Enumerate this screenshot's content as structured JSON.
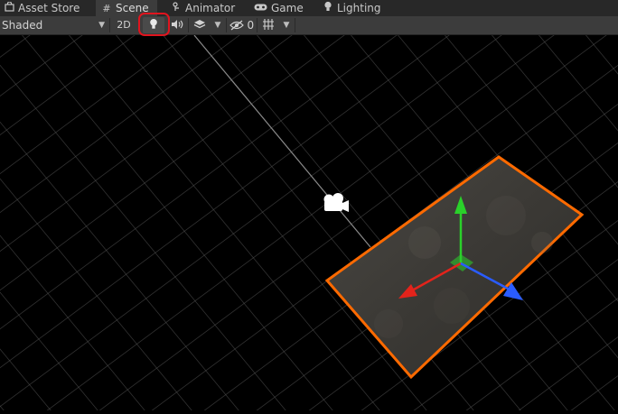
{
  "tabs": [
    {
      "label": "Asset Store",
      "icon": "shopping-bag-icon"
    },
    {
      "label": "Scene",
      "icon": "grid-hash-icon"
    },
    {
      "label": "Animator",
      "icon": "animator-node-icon"
    },
    {
      "label": "Game",
      "icon": "gamepad-icon"
    },
    {
      "label": "Lighting",
      "icon": "lightbulb-icon"
    }
  ],
  "active_tab": "Scene",
  "toolbar": {
    "draw_mode": "Shaded",
    "mode_2d": "2D",
    "lighting_toggle_icon": "lightbulb-icon",
    "audio_toggle_icon": "speaker-icon",
    "effects_icon": "layers-icon",
    "hidden_objects_count": "0",
    "gizmos_icon": "gizmo-grid-icon",
    "highlight_color": "#e0141e"
  },
  "scene": {
    "background_color": "#000000",
    "grid_color": "#5a5a5a",
    "selection_outline_color": "#ff6a00",
    "axis_colors": {
      "x": "#e3231b",
      "y": "#2ad12a",
      "z": "#2a5cff"
    },
    "camera_gizmo_icon": "camera-icon"
  }
}
